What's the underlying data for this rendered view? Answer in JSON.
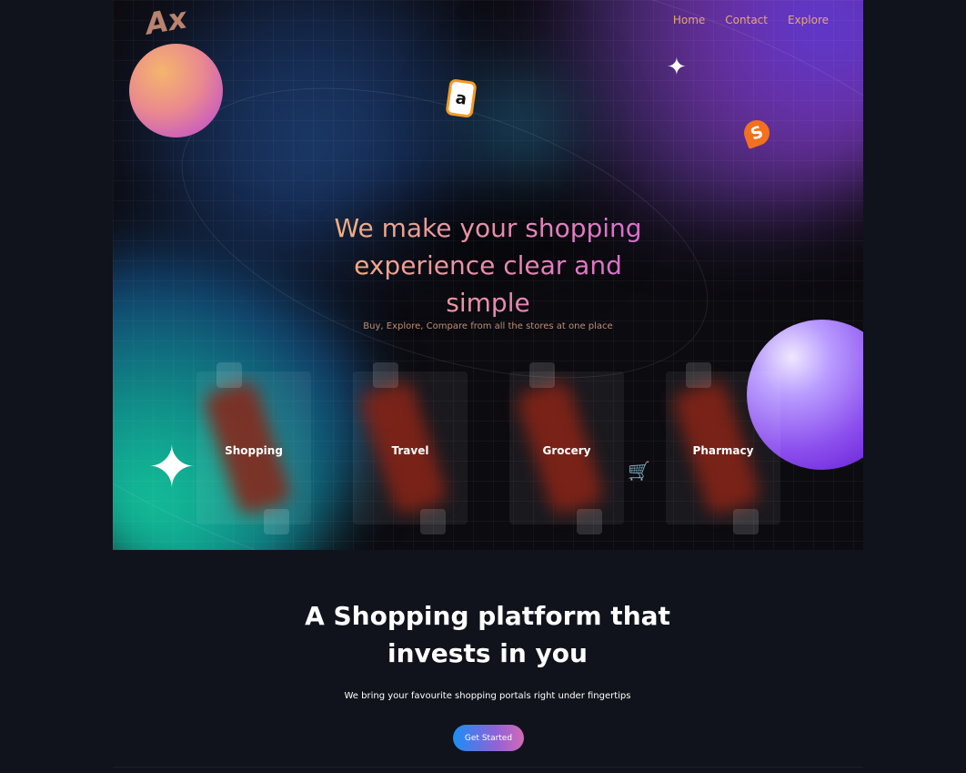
{
  "brand": {
    "logo_text": "Ax"
  },
  "nav": {
    "items": [
      "Home",
      "Contact",
      "Explore"
    ]
  },
  "hero": {
    "headline": "We make your shopping experience clear and simple",
    "subheadline": "Buy, Explore, Compare from all the stores at one place",
    "categories": [
      "Shopping",
      "Travel",
      "Grocery",
      "Pharmacy"
    ]
  },
  "icons": {
    "amazon": "a",
    "swiggy": "S",
    "sparkle": "✦",
    "cart": "🛒"
  },
  "section2": {
    "title": "A Shopping platform that invests in you",
    "subtitle": "We bring your favourite shopping portals right under fingertips",
    "cta_label": "Get Started"
  },
  "colors": {
    "page_bg": "#10131b",
    "heading_gradient_start": "#f2b27a",
    "heading_gradient_end": "#d56bd0",
    "nav_text": "#e6a678",
    "cta_gradient_start": "#1b8ef5",
    "cta_gradient_end": "#d36ab5"
  }
}
